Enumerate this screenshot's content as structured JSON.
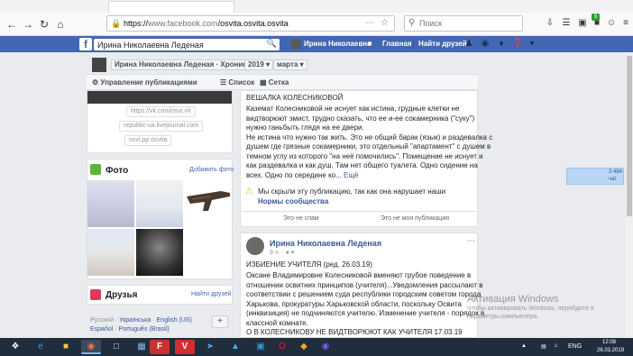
{
  "browser": {
    "url_scheme": "https://",
    "url_host": "www.facebook.com",
    "url_path": "/osvita.osvita.osvita",
    "search_placeholder": "Поиск",
    "badge": "9"
  },
  "fb_header": {
    "search_value": "Ирина Николаевна Леденая",
    "user_name": "Ирина Николаевна",
    "home": "Главная",
    "find_friends": "Найти друзей"
  },
  "timeline": {
    "profile_select": "Ирина Николаевна Леденая · Хроника",
    "year": "2019",
    "month": "марта",
    "manage": "Управление публикациями",
    "list": "Список",
    "grid": "Сетка"
  },
  "left": {
    "links": [
      "https://vk.com/osvi.vit",
      "republic-ua.livejournal.com",
      "osvi.pp.osvita"
    ],
    "photos_title": "Фото",
    "photos_add": "Добавить фото",
    "friends_title": "Друзья",
    "friends_find": "Найти друзей",
    "lang_line1": [
      "Русский",
      "Українська",
      "English (US)"
    ],
    "lang_line2": [
      "Español",
      "Português (Brasil)"
    ],
    "lang_add": "+"
  },
  "post1": {
    "title": "ВЕШАЛКА КОЛЕСНИКОВОЙ",
    "lines": [
      "Каземат Колесниковой не иснует как истина, грудные клетки не",
      "видтворюют змист, трудно сказать, что ее и-ее сокамерника (\"суку\")",
      "нужно ганьбыть глядя на ее двери.",
      "Не истина что нужно так жить. Это не общий барак (язык) и раздевалка с",
      "душем где грязные сокамерники, это отдельный \"апартамент\" с душем в",
      "темном углу из которого \"на неё помочились\". Помещение не иснует и",
      "как раздевалка и как душ. Там нет общего туалета. Одно сидение на",
      "всех. Одно по середине ко..."
    ],
    "more": "Ещё",
    "warning": "Мы скрыли эту публикацию, так как она нарушает наши",
    "warning_link": "Нормы сообщества",
    "btn_disagree": "Это не спам",
    "btn_not_mine": "Это не моя публикация"
  },
  "post2": {
    "author": "Ирина Николаевна Леденая",
    "meta": "9 ч. · ",
    "title": "ИЗБИЕНИЕ УЧИТЕЛЯ (ред. 26.03.19)",
    "lines": [
      "Оксане Владимировне Колесниковой вменяют грубое поведение в",
      "отношении освитних принципов (учителя)...Уведомления рассылают в",
      "соответствии с решением суда республики городским советом города",
      "Харькова, прокуратуры Харьковской области, поскольку Освита",
      "(инквизиция) не подчиняются учителю. Изменение учителя - порядок в",
      "классной комнате.",
      "О В КОЛЕСНИКОВУ НЕ ВИДТВОРЮЮТ КАК УЧИТЕЛЯ 17.03.19"
    ]
  },
  "chat": {
    "label": "3 484",
    "sub": "чат"
  },
  "watermark": {
    "title": "Активация Windows",
    "line1": "Чтобы активировать Windows, перейдите в",
    "line2": "параметры компьютера."
  },
  "taskbar": {
    "lang": "ENG",
    "time": "12:08",
    "date": "26.03.2019"
  }
}
